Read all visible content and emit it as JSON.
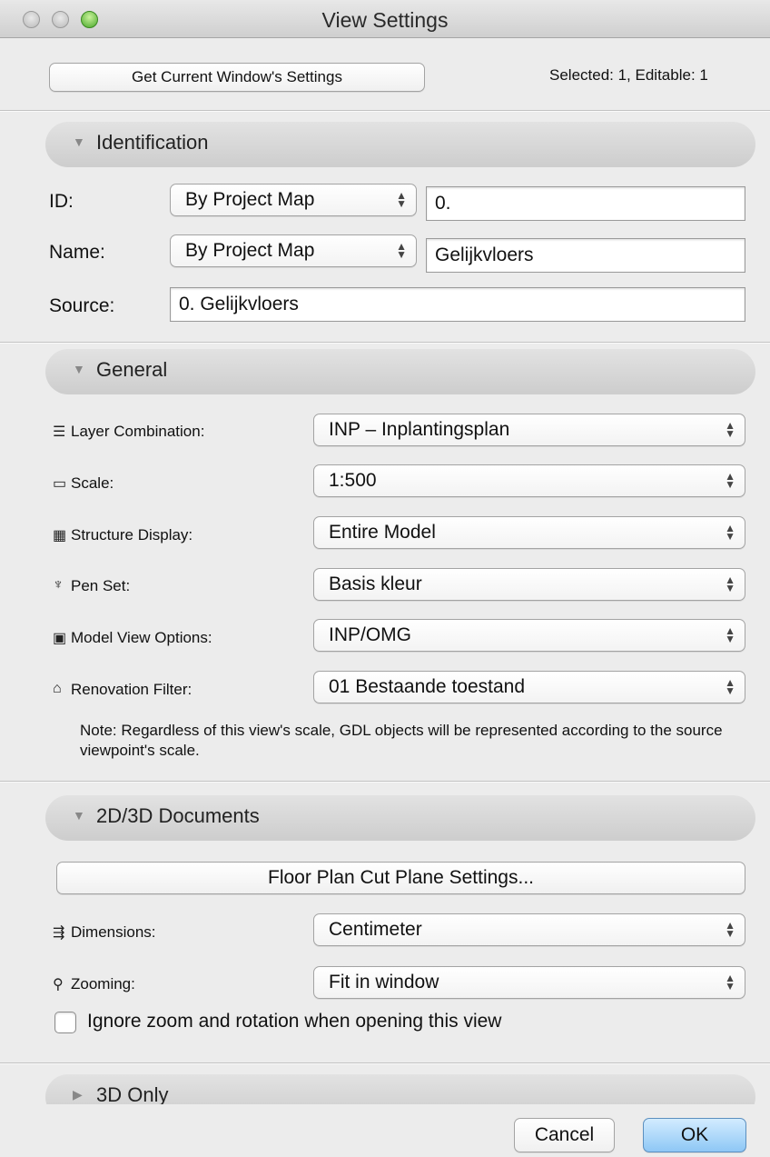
{
  "window": {
    "title": "View Settings"
  },
  "header": {
    "get_settings_label": "Get Current Window's Settings",
    "selection_status": "Selected: 1, Editable: 1"
  },
  "identification": {
    "title": "Identification",
    "id_label": "ID:",
    "id_mode": "By Project Map",
    "id_value": "0.",
    "name_label": "Name:",
    "name_mode": "By Project Map",
    "name_value": "Gelijkvloers",
    "source_label": "Source:",
    "source_value": "0. Gelijkvloers"
  },
  "general": {
    "title": "General",
    "rows": [
      {
        "icon": "layer-combination-icon",
        "label": "Layer Combination:",
        "value": "INP – Inplantingsplan"
      },
      {
        "icon": "scale-icon",
        "label": "Scale:",
        "value": "1:500"
      },
      {
        "icon": "structure-display-icon",
        "label": "Structure Display:",
        "value": "Entire Model"
      },
      {
        "icon": "pen-set-icon",
        "label": "Pen Set:",
        "value": "Basis kleur"
      },
      {
        "icon": "model-view-options-icon",
        "label": "Model View Options:",
        "value": "INP/OMG"
      },
      {
        "icon": "renovation-filter-icon",
        "label": "Renovation Filter:",
        "value": "01 Bestaande toestand"
      }
    ],
    "note": "Note: Regardless of this view's scale, GDL objects will be represented according to the source viewpoint's scale."
  },
  "documents": {
    "title": "2D/3D Documents",
    "cut_plane_label": "Floor Plan Cut Plane Settings...",
    "dimensions_label": "Dimensions:",
    "dimensions_value": "Centimeter",
    "zooming_label": "Zooming:",
    "zooming_value": "Fit in window",
    "ignore_zoom_label": "Ignore zoom and rotation when opening this view"
  },
  "three_d": {
    "title": "3D Only"
  },
  "footer": {
    "cancel_label": "Cancel",
    "ok_label": "OK"
  },
  "colors": {
    "ok_button": "#8ec7f5",
    "zoom_light": "#49a82a"
  }
}
